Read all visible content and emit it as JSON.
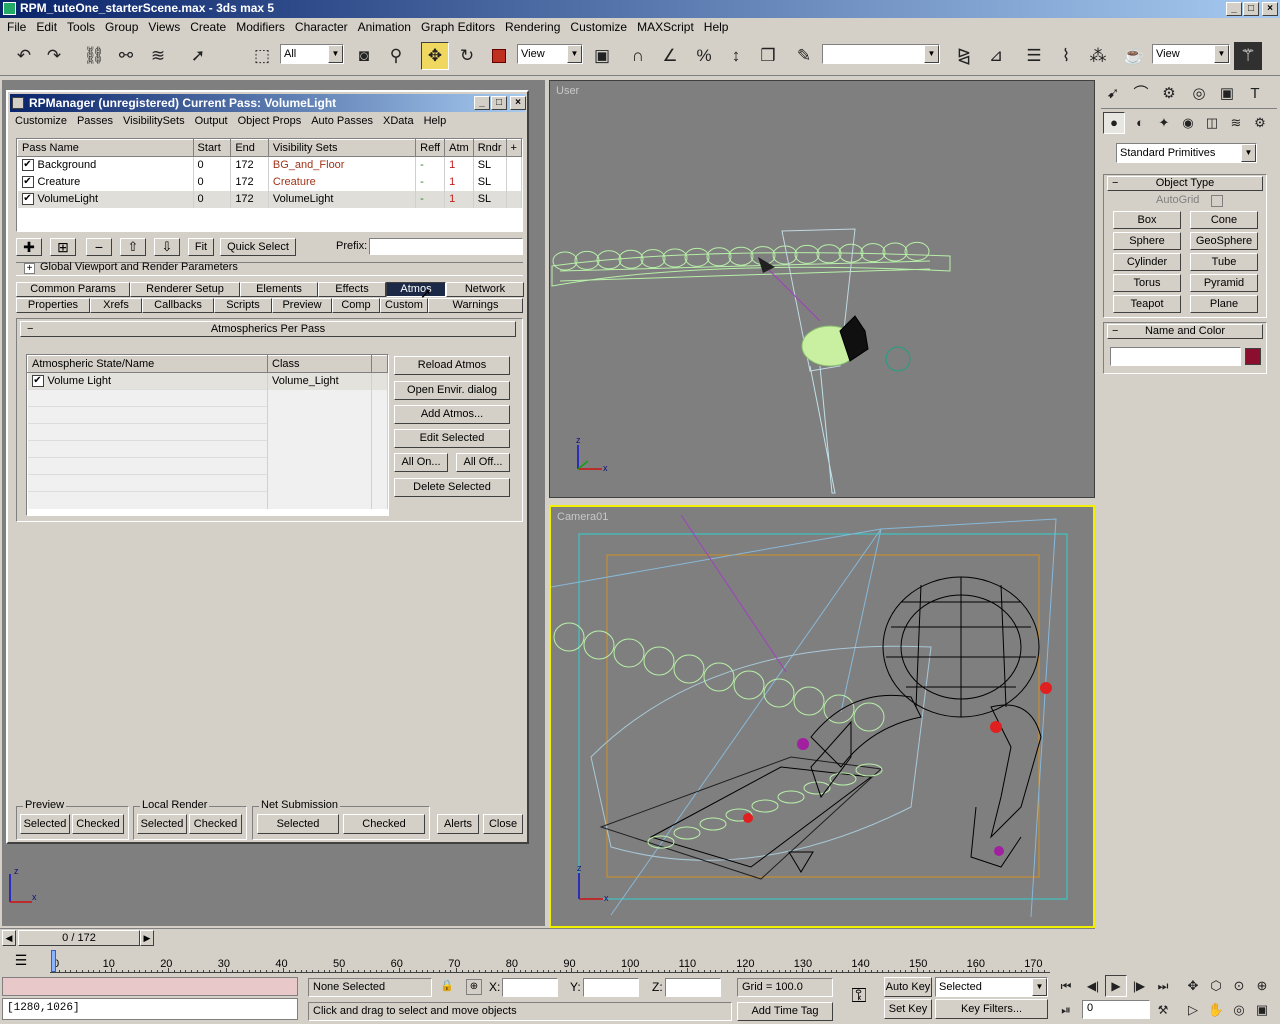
{
  "app": {
    "title": "RPM_tuteOne_starterScene.max - 3ds max 5",
    "menu": [
      "File",
      "Edit",
      "Tools",
      "Group",
      "Views",
      "Create",
      "Modifiers",
      "Character",
      "Animation",
      "Graph Editors",
      "Rendering",
      "Customize",
      "MAXScript",
      "Help"
    ]
  },
  "toolbar": {
    "selection_filter": "All",
    "ref_coord": "View",
    "named_sel": "",
    "render_view": "View",
    "icons": [
      "undo-icon",
      "redo-icon",
      "link-icon",
      "unlink-icon",
      "bind-space-warp-icon",
      "select-icon",
      "region-select-icon",
      "select-by-name-icon",
      "select-and-move-icon",
      "select-and-rotate-icon",
      "select-and-scale-icon",
      "pivot-icon",
      "mirror-icon",
      "align-icon",
      "snap-icon",
      "angle-snap-icon",
      "percent-snap-icon",
      "spinner-snap-icon",
      "named-selection-icon",
      "curve-editor-icon",
      "schematic-icon",
      "material-editor-icon",
      "render-scene-icon",
      "quick-render-icon"
    ]
  },
  "rpm": {
    "title": "RPManager (unregistered)   Current Pass: VolumeLight",
    "menu": [
      "Customize",
      "Passes",
      "VisibilitySets",
      "Output",
      "Object Props",
      "Auto Passes",
      "XData",
      "Help"
    ],
    "columns": [
      "Pass Name",
      "Start",
      "End",
      "Visibility Sets",
      "Reff",
      "Atm",
      "Rndr",
      "+"
    ],
    "passes": [
      {
        "name": "Background",
        "start": "0",
        "end": "172",
        "visibility": "BG_and_Floor",
        "reff": "-",
        "atm": "1",
        "rndr": "SL",
        "checked": true
      },
      {
        "name": "Creature",
        "start": "0",
        "end": "172",
        "visibility": "Creature",
        "reff": "-",
        "atm": "1",
        "rndr": "SL",
        "checked": true
      },
      {
        "name": "VolumeLight",
        "start": "0",
        "end": "172",
        "visibility": "VolumeLight",
        "reff": "-",
        "atm": "1",
        "rndr": "SL",
        "checked": true
      }
    ],
    "buttons": {
      "fit": "Fit",
      "quick_select": "Quick Select",
      "prefix_label": "Prefix:",
      "prefix_value": ""
    },
    "global_rollout": "Global Viewport and Render Parameters",
    "tabs_row1": [
      "Common Params",
      "Renderer Setup",
      "Elements",
      "Effects",
      "Atmos",
      "Network"
    ],
    "tabs_row2": [
      "Properties",
      "Xrefs",
      "Callbacks",
      "Scripts",
      "Preview",
      "Comp",
      "Custom",
      "Warnings"
    ],
    "selected_tab": "Atmos",
    "atmos_rollout": "Atmospherics Per Pass",
    "atmos_columns": [
      "Atmospheric State/Name",
      "Class"
    ],
    "atmos_rows": [
      {
        "name": "Volume Light",
        "class": "Volume_Light",
        "checked": true
      }
    ],
    "atmos_buttons": [
      "Reload Atmos",
      "Open Envir. dialog",
      "Add Atmos...",
      "Edit Selected",
      "All On...",
      "All Off...",
      "Delete Selected"
    ],
    "preview_group": {
      "label": "Preview",
      "b1": "Selected",
      "b2": "Checked"
    },
    "local_group": {
      "label": "Local Render",
      "b1": "Selected",
      "b2": "Checked"
    },
    "net_group": {
      "label": "Net Submission",
      "b1": "Selected",
      "b2": "Checked"
    },
    "alerts": "Alerts",
    "close": "Close"
  },
  "viewports": {
    "top_right": "User",
    "bottom_right": "Camera01"
  },
  "cmd_panel": {
    "dropdown": "Standard Primitives",
    "object_type": "Object Type",
    "autogrid": "AutoGrid",
    "primitives": [
      "Box",
      "Cone",
      "Sphere",
      "GeoSphere",
      "Cylinder",
      "Tube",
      "Torus",
      "Pyramid",
      "Teapot",
      "Plane"
    ],
    "name_color": "Name and Color",
    "name_value": "",
    "swatch_color": "#8b0e2e"
  },
  "timeline": {
    "frame": "0 / 172",
    "ticks": [
      "0",
      "10",
      "20",
      "30",
      "40",
      "50",
      "60",
      "70",
      "80",
      "90",
      "100",
      "110",
      "120",
      "130",
      "140",
      "150",
      "160",
      "170"
    ]
  },
  "status": {
    "listener": "[1280,1026]",
    "selection": "None Selected",
    "x": "",
    "y": "",
    "z": "",
    "grid": "Grid = 100.0",
    "prompt": "Click and drag to select and move objects",
    "add_time_tag": "Add Time Tag",
    "auto_key": "Auto Key",
    "set_key": "Set Key",
    "key_mode": "Selected",
    "key_filters": "Key Filters...",
    "frame_field": "0"
  }
}
